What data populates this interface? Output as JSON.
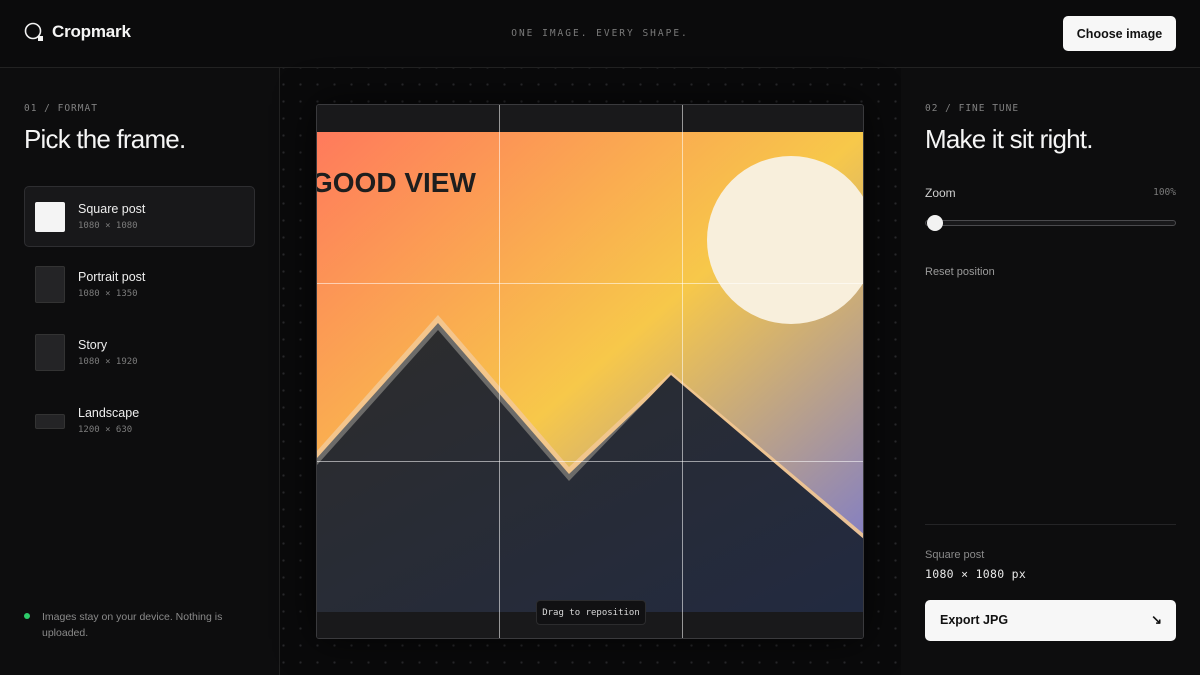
{
  "header": {
    "brand": "Cropmark",
    "tagline": "ONE IMAGE. EVERY SHAPE.",
    "choose_button": "Choose image"
  },
  "format_panel": {
    "kicker": "01 / FORMAT",
    "title": "Pick the frame.",
    "selected": "Square post",
    "formats": [
      {
        "name": "Square post",
        "size": "1080 × 1080"
      },
      {
        "name": "Portrait post",
        "size": "1080 × 1350"
      },
      {
        "name": "Story",
        "size": "1080 × 1920"
      },
      {
        "name": "Landscape",
        "size": "1200 × 630"
      }
    ],
    "privacy_note": "Images stay on your device. Nothing is uploaded."
  },
  "stage": {
    "image_text": "GOOD VIEW",
    "drag_hint": "Drag to reposition"
  },
  "fine_tune_panel": {
    "kicker": "02 / FINE TUNE",
    "title": "Make it sit right.",
    "zoom_label": "Zoom",
    "zoom_value": "100%",
    "zoom_level": 0,
    "reset_label": "Reset position",
    "summary_format": "Square post",
    "summary_size": "1080 × 1080 px",
    "export_label": "Export JPG",
    "export_icon": "arrow-down-right-icon"
  },
  "colors": {
    "accent_status": "#2dcc6a",
    "button_bg": "#f7f7f7",
    "background": "#0b0b0c"
  }
}
